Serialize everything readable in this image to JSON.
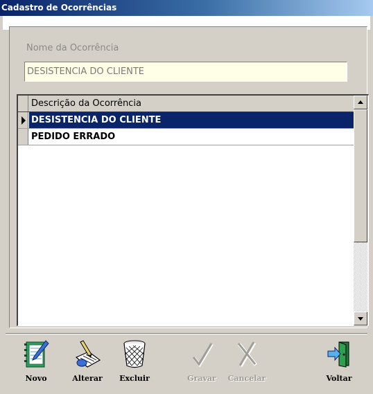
{
  "window": {
    "title": "Cadastro de Ocorrências"
  },
  "form": {
    "field_label": "Nome da Ocorrência",
    "field_value": "DESISTENCIA DO CLIENTE"
  },
  "grid": {
    "column_header": "Descrição da Ocorrência",
    "rows": [
      {
        "label": "DESISTENCIA DO CLIENTE",
        "selected": true
      },
      {
        "label": "PEDIDO ERRADO",
        "selected": false
      }
    ]
  },
  "toolbar": {
    "novo_label": "Novo",
    "alterar_label": "Alterar",
    "excluir_label": "Excluir",
    "gravar_label": "Gravar",
    "cancelar_label": "Cancelar",
    "voltar_label": "Voltar"
  },
  "icons": {
    "novo": "notebook-pencil-icon",
    "alterar": "edit-document-icon",
    "excluir": "trash-bin-icon",
    "gravar": "checkmark-icon",
    "cancelar": "cross-icon",
    "voltar": "exit-door-icon"
  },
  "colors": {
    "title_bar": "#0a246a",
    "selection": "#0a246a",
    "input_background": "#ffffe8",
    "window_background": "#d4d0c8"
  }
}
